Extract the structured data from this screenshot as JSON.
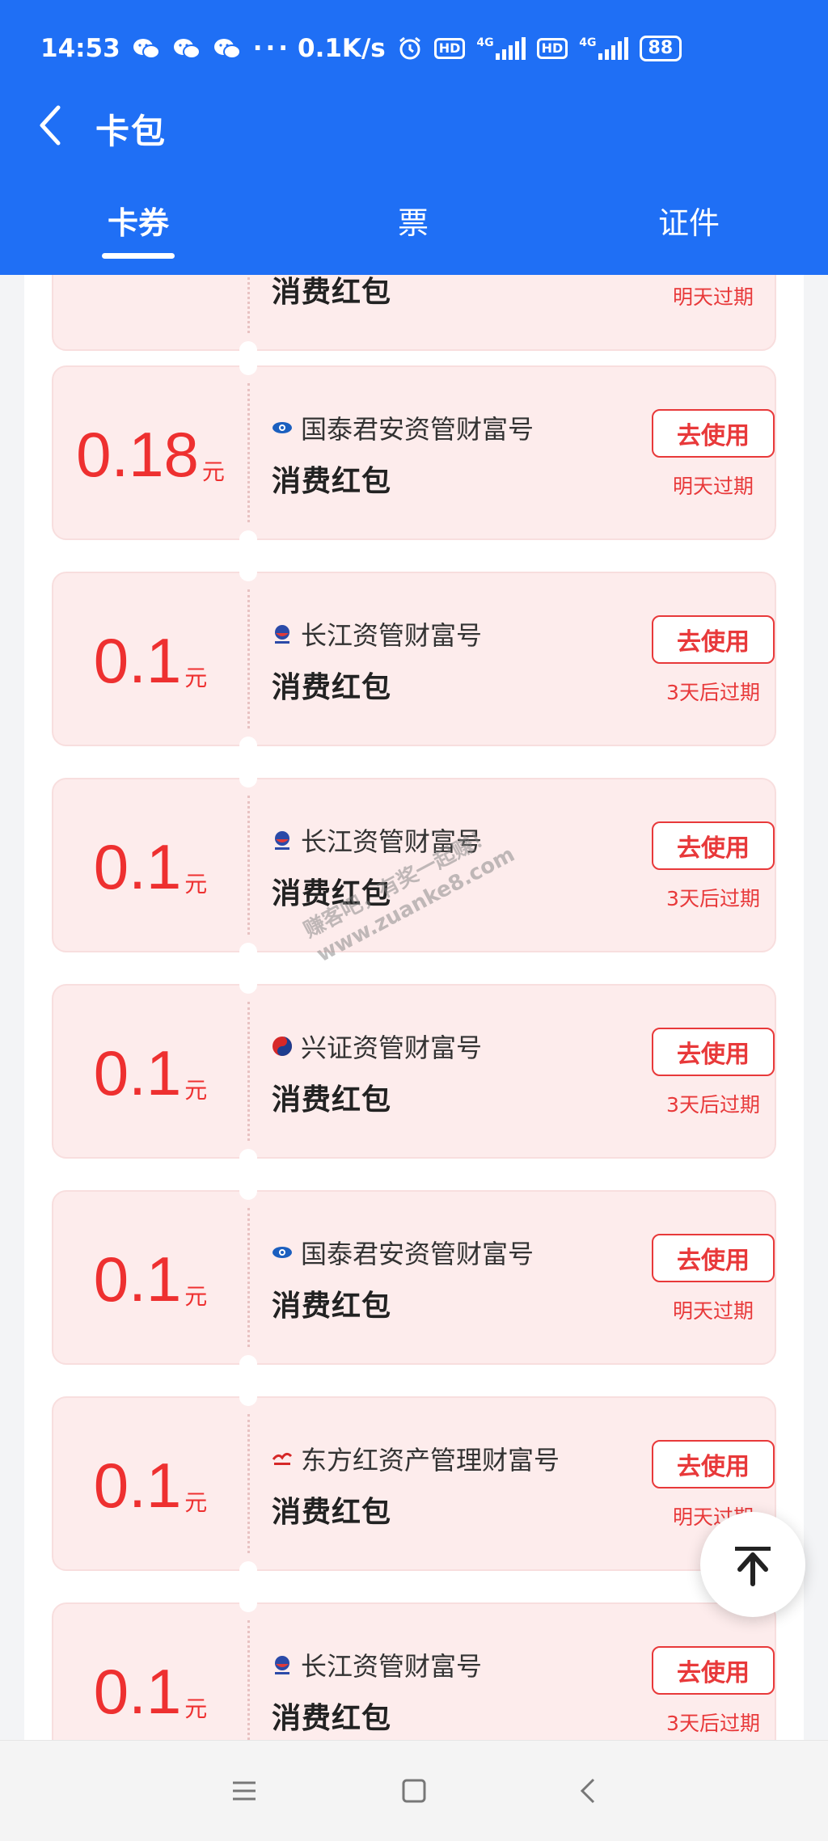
{
  "status_bar": {
    "time": "14:53",
    "more": "···",
    "network_speed": "0.1K/s",
    "hd1": "HD",
    "hd2": "HD",
    "net1": "4G",
    "net2": "4G",
    "battery": "88",
    "icons": [
      "wechat-icon",
      "wechat-icon",
      "wechat-icon",
      "alarm-icon",
      "signal-icon",
      "battery-icon"
    ]
  },
  "header": {
    "title": "卡包",
    "back_icon": "chevron-left-icon",
    "color": "#1f6ff5"
  },
  "tabs": [
    {
      "label": "卡券",
      "active": true
    },
    {
      "label": "票",
      "active": false
    },
    {
      "label": "证件",
      "active": false
    }
  ],
  "coupons": [
    {
      "amount": "",
      "unit": "",
      "issuer": "",
      "type": "消费红包",
      "button": "",
      "expiry": "明天过期",
      "logo": ""
    },
    {
      "amount": "0.18",
      "unit": "元",
      "issuer": "国泰君安资管财富号",
      "type": "消费红包",
      "button": "去使用",
      "expiry": "明天过期",
      "logo": "eye-logo-icon"
    },
    {
      "amount": "0.1",
      "unit": "元",
      "issuer": "长江资管财富号",
      "type": "消费红包",
      "button": "去使用",
      "expiry": "3天后过期",
      "logo": "changjiang-logo-icon"
    },
    {
      "amount": "0.1",
      "unit": "元",
      "issuer": "长江资管财富号",
      "type": "消费红包",
      "button": "去使用",
      "expiry": "3天后过期",
      "logo": "changjiang-logo-icon"
    },
    {
      "amount": "0.1",
      "unit": "元",
      "issuer": "兴证资管财富号",
      "type": "消费红包",
      "button": "去使用",
      "expiry": "3天后过期",
      "logo": "xingzheng-logo-icon"
    },
    {
      "amount": "0.1",
      "unit": "元",
      "issuer": "国泰君安资管财富号",
      "type": "消费红包",
      "button": "去使用",
      "expiry": "明天过期",
      "logo": "eye-logo-icon"
    },
    {
      "amount": "0.1",
      "unit": "元",
      "issuer": "东方红资产管理财富号",
      "type": "消费红包",
      "button": "去使用",
      "expiry": "明天过期",
      "logo": "dongfanghong-logo-icon"
    },
    {
      "amount": "0.1",
      "unit": "元",
      "issuer": "长江资管财富号",
      "type": "消费红包",
      "button": "去使用",
      "expiry": "3天后过期",
      "logo": "changjiang-logo-icon"
    }
  ],
  "watermark": {
    "line1": "赚客吧，有奖一起赚！",
    "line2": "www.zuanke8.com"
  },
  "back_to_top_icon": "arrow-up-to-top-icon",
  "nav_icons": [
    "menu-icon",
    "home-square-icon",
    "back-icon"
  ],
  "colors": {
    "accent": "#1f6ff5",
    "coupon_red": "#ee3030",
    "coupon_bg": "#fdecec"
  }
}
